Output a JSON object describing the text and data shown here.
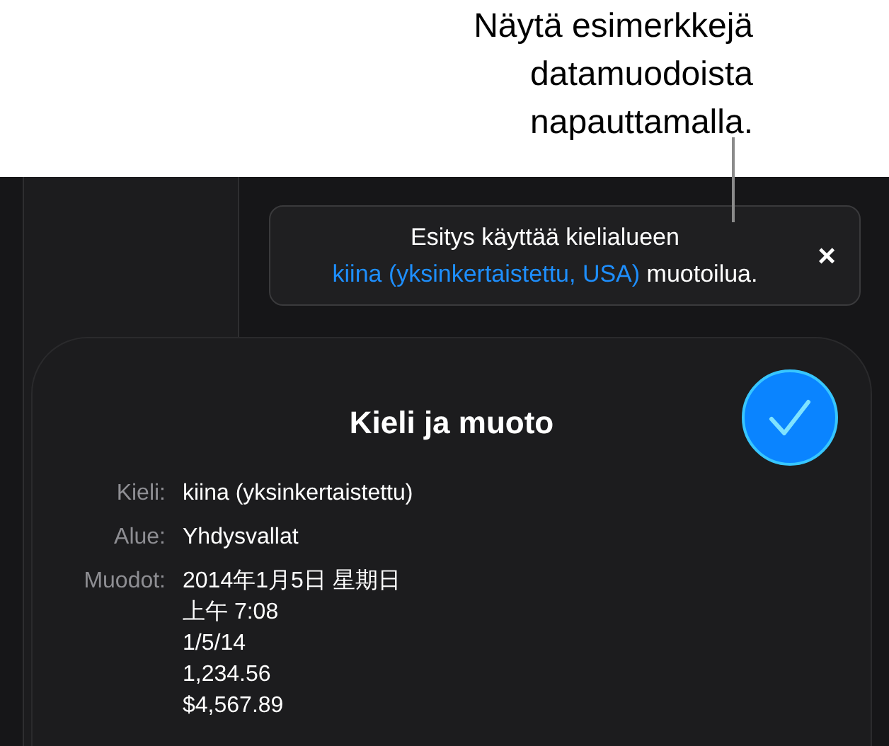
{
  "callout": {
    "lines": [
      "Näytä esimerkkejä",
      "datamuodoista",
      "napauttamalla."
    ]
  },
  "banner": {
    "text_before": "Esitys käyttää kielialueen",
    "link": "kiina (yksinkertaistettu, USA)",
    "text_after": "muotoilua.",
    "close": "×"
  },
  "sheet": {
    "title": "Kieli ja muoto",
    "rows": [
      {
        "label": "Kieli:",
        "values": [
          "kiina (yksinkertaistettu)"
        ]
      },
      {
        "label": "Alue:",
        "values": [
          "Yhdysvallat"
        ]
      },
      {
        "label": "Muodot:",
        "values": [
          "2014年1月5日 星期日",
          "上午 7:08",
          "1/5/14",
          "1,234.56",
          "$4,567.89"
        ]
      }
    ]
  }
}
